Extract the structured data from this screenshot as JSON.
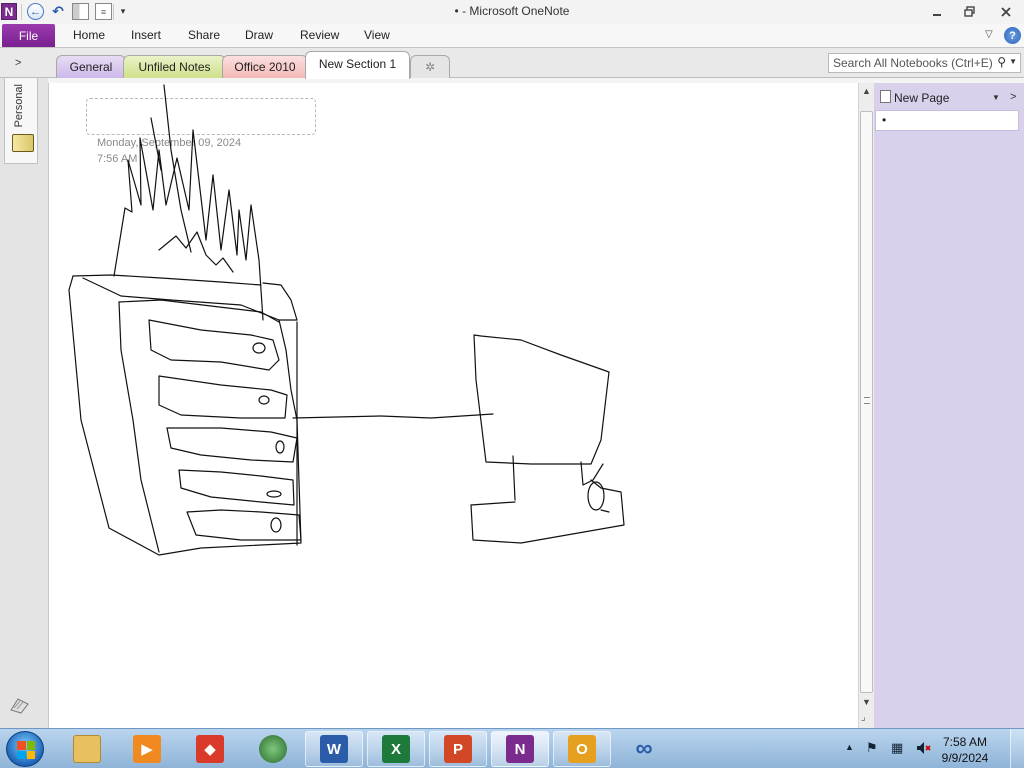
{
  "app": {
    "title": "- Microsoft OneNote",
    "title_dot": "•",
    "logo_letter": "N"
  },
  "ribbon": {
    "file": "File",
    "tabs": [
      "Home",
      "Insert",
      "Share",
      "Draw",
      "Review",
      "View"
    ]
  },
  "sections": {
    "tabs": [
      {
        "label": "General",
        "color": "#cdb8ea"
      },
      {
        "label": "Unfiled Notes",
        "color": "#cfe08a"
      },
      {
        "label": "Office 2010",
        "color": "#f4b8b6"
      },
      {
        "label": "New Section 1",
        "color": "#ffffff",
        "active": true
      }
    ],
    "add_tab_icon": "sparkle-icon"
  },
  "search": {
    "placeholder": "Search All Notebooks (Ctrl+E)"
  },
  "notebook": {
    "name": "Personal"
  },
  "page": {
    "date": "Monday, September  09, 2024",
    "time": "7:56 AM"
  },
  "pagelist": {
    "new_page": "New Page",
    "items": [
      "•"
    ]
  },
  "taskbar": {
    "apps": [
      {
        "name": "explorer",
        "glyph": "",
        "color": "#e8c060"
      },
      {
        "name": "media-player",
        "glyph": "▶",
        "color": "#f08a20"
      },
      {
        "name": "red-app",
        "glyph": "◆",
        "color": "#d93a2a"
      },
      {
        "name": "browser",
        "glyph": "●",
        "color": "#3a8a3a"
      },
      {
        "name": "word",
        "glyph": "W",
        "color": "#2a5caa"
      },
      {
        "name": "excel",
        "glyph": "X",
        "color": "#1e7a3a"
      },
      {
        "name": "powerpoint",
        "glyph": "P",
        "color": "#d24726"
      },
      {
        "name": "onenote",
        "glyph": "N",
        "color": "#7a2b8d"
      },
      {
        "name": "outlook",
        "glyph": "O",
        "color": "#e6a020"
      },
      {
        "name": "infinity-app",
        "glyph": "∞",
        "color": "#2a5caa"
      }
    ],
    "time": "7:58 AM",
    "date": "9/9/2024"
  }
}
